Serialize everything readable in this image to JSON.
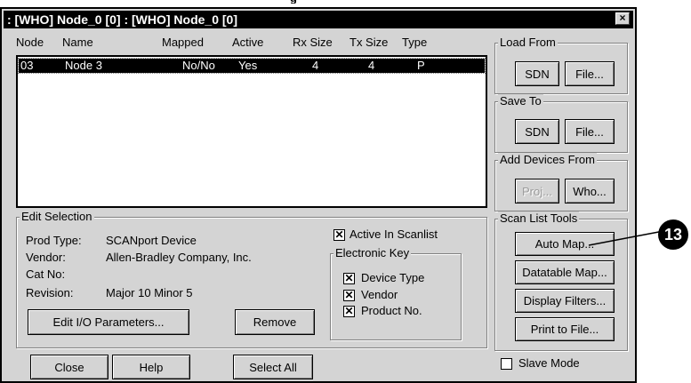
{
  "top_cut_label": "g",
  "window": {
    "title": ": [WHO] Node_0 [0] : [WHO] Node_0 [0]",
    "close_glyph": "×"
  },
  "list": {
    "headers": [
      "Node",
      "Name",
      "Mapped",
      "Active",
      "Rx Size",
      "Tx Size",
      "Type"
    ],
    "rows": [
      {
        "node": "03",
        "name": "Node 3",
        "mapped": "No/No",
        "active": "Yes",
        "rx": "4",
        "tx": "4",
        "type": "P"
      }
    ]
  },
  "load_from": {
    "legend": "Load From",
    "sdn": "SDN",
    "file": "File..."
  },
  "save_to": {
    "legend": "Save To",
    "sdn": "SDN",
    "file": "File..."
  },
  "add_devices": {
    "legend": "Add Devices From",
    "proj": "Proj...",
    "who": "Who..."
  },
  "scan_tools": {
    "legend": "Scan List Tools",
    "auto_map": "Auto Map...",
    "datatable_map": "Datatable Map...",
    "display_filters": "Display Filters...",
    "print_to_file": "Print to File..."
  },
  "edit_selection": {
    "legend": "Edit Selection",
    "prod_type_label": "Prod Type:",
    "prod_type_value": "SCANport Device",
    "vendor_label": "Vendor:",
    "vendor_value": "Allen-Bradley Company, Inc.",
    "cat_label": "Cat No:",
    "cat_value": "",
    "revision_label": "Revision:",
    "revision_value": "Major 10 Minor 5",
    "edit_io_button": "Edit I/O Parameters...",
    "remove_button": "Remove",
    "active_in_scanlist": "Active In Scanlist",
    "electronic_key_legend": "Electronic Key",
    "device_type": "Device Type",
    "vendor_cb": "Vendor",
    "product_no": "Product No.",
    "check_glyph": "✕"
  },
  "bottom": {
    "close": "Close",
    "help": "Help",
    "select_all": "Select All",
    "slave_mode": "Slave Mode"
  },
  "callout_number": "13",
  "colors": {
    "window_bg": "#d4d4d4",
    "titlebar": "#000000",
    "selection": "#000000"
  }
}
